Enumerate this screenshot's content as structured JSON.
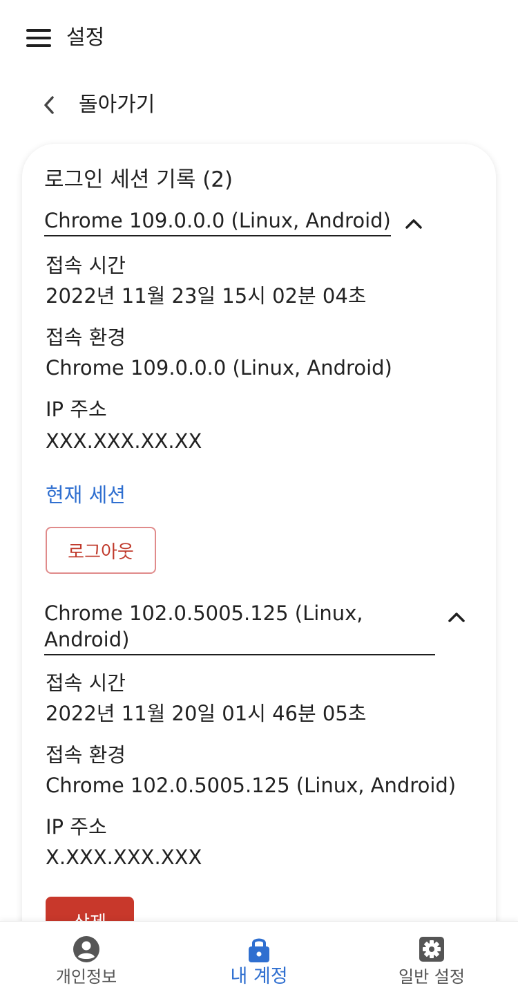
{
  "app": {
    "title": "설정"
  },
  "back": {
    "label": "돌아가기"
  },
  "sessions_card": {
    "title": "로그인 세션 기록 (2)",
    "sessions": [
      {
        "header": "Chrome 109.0.0.0 (Linux, Android)",
        "access_time_label": "접속 시간",
        "access_time": "2022년 11월 23일 15시 02분 04초",
        "env_label": "접속 환경",
        "env": "Chrome 109.0.0.0 (Linux, Android)",
        "ip_label": "IP 주소",
        "ip": "XXX.XXX.XX.XX",
        "current_label": "현재 세션",
        "action_label": "로그아웃"
      },
      {
        "header_line1": "Chrome 102.0.5005.125 (Linux,",
        "header_line2": "Android)",
        "access_time_label": "접속 시간",
        "access_time": "2022년 11월 20일 01시 46분 05초",
        "env_label": "접속 환경",
        "env": "Chrome 102.0.5005.125 (Linux, Android)",
        "ip_label": "IP 주소",
        "ip": "X.XXX.XXX.XXX",
        "action_label": "삭제"
      }
    ]
  },
  "bottom_nav": {
    "items": [
      {
        "label": "개인정보",
        "icon": "account-circle-icon",
        "active": false
      },
      {
        "label": "내 계정",
        "icon": "lock-icon",
        "active": true
      },
      {
        "label": "일반 설정",
        "icon": "gear-icon",
        "active": false
      }
    ]
  },
  "colors": {
    "accent": "#2f6fd0",
    "danger": "#c8382b",
    "danger_border": "#e08b8b",
    "text": "#1f1f1f",
    "nav_inactive": "#555555"
  }
}
